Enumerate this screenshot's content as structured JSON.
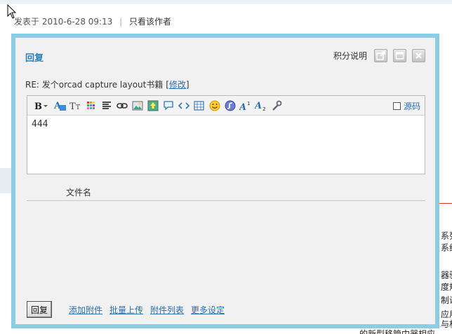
{
  "post": {
    "posted_label": "发表于",
    "posted_time": "2010-6-28 09:13",
    "only_author": "只看该作者"
  },
  "dialog": {
    "title": "回复",
    "points_label": "积分说明",
    "subject_prefix": "RE: 发个orcad capture layout书籍",
    "edit_link": "修改",
    "editor": {
      "content": "444",
      "source_label": "源码",
      "toolbar": [
        "bold-icon",
        "font-color-icon",
        "font-size-icon",
        "color-grid-icon",
        "align-icon",
        "link-icon",
        "image-icon",
        "upload-image-icon",
        "quote-icon",
        "code-icon",
        "table-icon",
        "smiley-icon",
        "flash-icon",
        "superscript-icon",
        "subscript-icon",
        "tools-icon"
      ]
    },
    "file_header": "文件名",
    "reply_button": "回复",
    "links": {
      "add_attachment": "添加附件",
      "batch_upload": "批量上传",
      "attachment_list": "附件列表",
      "more_settings": "更多设定"
    }
  },
  "background": {
    "frag1": "系列",
    "frag2": "系统",
    "frag3": "器驱",
    "frag4": "度规",
    "frag5": "制说",
    "frag6": "应用",
    "frag7": "与相",
    "frag8": "的新型移管中器相应"
  }
}
